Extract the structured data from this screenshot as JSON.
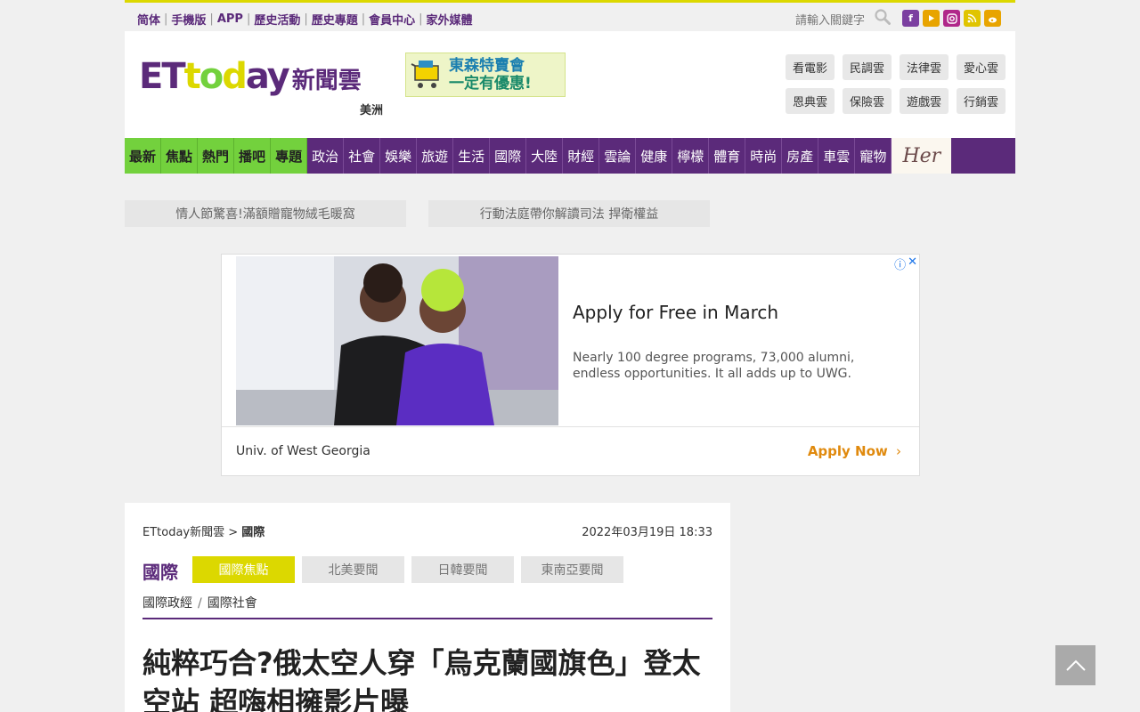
{
  "topbar": {
    "links": [
      "简体",
      "手機版",
      "APP",
      "歷史活動",
      "歷史專題",
      "會員中心",
      "家外媒體"
    ],
    "search_placeholder": "請輸入關鍵字",
    "social_icons": [
      "facebook-icon",
      "youtube-icon",
      "instagram-icon",
      "rss-icon",
      "weibo-icon"
    ]
  },
  "header": {
    "logo_et": "ET",
    "logo_today": "today",
    "logo_cn": "新聞雲",
    "region": "美洲",
    "banner_line1": "東森特賣會",
    "banner_line2": "一定有優惠!",
    "clouds": [
      "看電影",
      "民調雲",
      "法律雲",
      "愛心雲",
      "恩典雲",
      "保險雲",
      "遊戲雲",
      "行銷雲"
    ]
  },
  "nav": {
    "highlight_items": [
      "最新",
      "焦點",
      "熱門",
      "播吧",
      "專題"
    ],
    "items": [
      "政治",
      "社會",
      "娛樂",
      "旅遊",
      "生活",
      "國際",
      "大陸",
      "財經",
      "雲論",
      "健康",
      "檸檬",
      "體育",
      "時尚",
      "房產",
      "車雲",
      "寵物"
    ],
    "her_label": "Her"
  },
  "promos": [
    "情人節驚喜!滿額贈寵物絨毛暖窩",
    "行動法庭帶你解讀司法 捍衛權益"
  ],
  "ad": {
    "title": "Apply for Free in March",
    "description": "Nearly 100 degree programs, 73,000 alumni, endless opportunities. It all adds up to UWG.",
    "brand": "Univ. of West Georgia",
    "cta": "Apply Now"
  },
  "article": {
    "breadcrumb_root": "ETtoday新聞雲 >",
    "breadcrumb_current": "國際",
    "date": "2022年03月19日 18:33",
    "section": "國際",
    "subtabs": [
      "國際焦點",
      "北美要聞",
      "日韓要聞",
      "東南亞要聞"
    ],
    "sublinks": [
      "國際政經",
      "國際社會"
    ],
    "headline": "純粹巧合?俄太空人穿「烏克蘭國旗色」登太空站 超嗨相擁影片曝"
  },
  "colors": {
    "brand_purple": "#5b2a7a",
    "accent_yellow": "#dcd800",
    "nav_green": "#73d13d",
    "cta_orange": "#e08a0e"
  }
}
